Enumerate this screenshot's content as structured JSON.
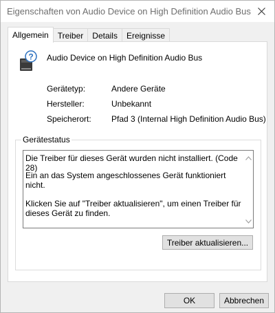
{
  "window": {
    "title": "Eigenschaften von Audio Device on High Definition Audio Bus",
    "close_icon": "close-icon"
  },
  "tabs": [
    {
      "label": "Allgemein",
      "active": true
    },
    {
      "label": "Treiber",
      "active": false
    },
    {
      "label": "Details",
      "active": false
    },
    {
      "label": "Ereignisse",
      "active": false
    }
  ],
  "device": {
    "icon": "unknown-device-icon",
    "name": "Audio Device on High Definition Audio Bus"
  },
  "properties": [
    {
      "label": "Gerätetyp:",
      "value": "Andere Geräte"
    },
    {
      "label": "Hersteller:",
      "value": "Unbekannt"
    },
    {
      "label": "Speicherort:",
      "value": "Pfad 3 (Internal High Definition Audio Bus)"
    }
  ],
  "status": {
    "group_title": "Gerätestatus",
    "lines": [
      "Die Treiber für dieses Gerät wurden nicht installiert. (Code 28)",
      "Ein an das System angeschlossenes Gerät funktioniert nicht.",
      "Klicken Sie auf \"Treiber aktualisieren\", um einen Treiber für dieses Gerät zu finden."
    ],
    "update_button": "Treiber aktualisieren..."
  },
  "footer": {
    "ok_label": "OK",
    "cancel_label": "Abbrechen"
  }
}
